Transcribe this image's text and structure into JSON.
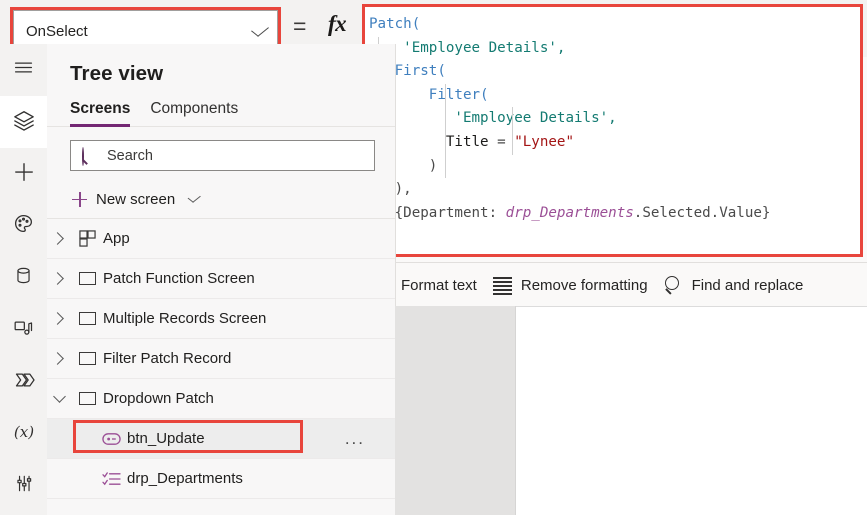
{
  "property_selector": {
    "value": "OnSelect",
    "chevron_icon": "chevron-down-icon"
  },
  "formula_bar": {
    "equals_sign": "=",
    "fx_symbol": "fx",
    "lines": [
      {
        "tokens": [
          {
            "t": "Patch(",
            "c": "fn"
          }
        ],
        "guides": 0
      },
      {
        "tokens": [
          {
            "t": "    ",
            "c": "plain"
          },
          {
            "t": "'Employee Details',",
            "c": "str"
          }
        ],
        "guides": 1
      },
      {
        "tokens": [
          {
            "t": "   ",
            "c": "plain"
          },
          {
            "t": "First(",
            "c": "fn"
          }
        ],
        "guides": 1
      },
      {
        "tokens": [
          {
            "t": "       ",
            "c": "plain"
          },
          {
            "t": "Filter(",
            "c": "fn"
          }
        ],
        "guides": 2
      },
      {
        "tokens": [
          {
            "t": "          ",
            "c": "plain"
          },
          {
            "t": "'Employee Details',",
            "c": "str"
          }
        ],
        "guides": 3
      },
      {
        "tokens": [
          {
            "t": "         ",
            "c": "plain"
          },
          {
            "t": "Title",
            "c": "ident"
          },
          {
            "t": " = ",
            "c": "punc"
          },
          {
            "t": "\"Lynee\"",
            "c": "dqst"
          }
        ],
        "guides": 3
      },
      {
        "tokens": [
          {
            "t": "       ",
            "c": "plain"
          },
          {
            "t": ")",
            "c": "punc"
          }
        ],
        "guides": 2
      },
      {
        "tokens": [
          {
            "t": "   ",
            "c": "plain"
          },
          {
            "t": "),",
            "c": "punc"
          }
        ],
        "guides": 1
      },
      {
        "tokens": [
          {
            "t": "   ",
            "c": "plain"
          },
          {
            "t": "{Department: ",
            "c": "punc"
          },
          {
            "t": "drp_Departments",
            "c": "ctrl"
          },
          {
            "t": ".Selected.Value}",
            "c": "punc"
          }
        ],
        "guides": 1
      },
      {
        "tokens": [
          {
            "t": ")",
            "c": "punc"
          }
        ],
        "guides": 0
      }
    ],
    "toolbar": {
      "format_text": "Format text",
      "remove_formatting": "Remove formatting",
      "find_and_replace": "Find and replace"
    }
  },
  "rail": {
    "items": [
      {
        "icon": "hamburger-menu-icon",
        "name": "menu",
        "active": false
      },
      {
        "icon": "layers-tree-view-icon",
        "name": "tree-view",
        "active": true
      },
      {
        "icon": "plus-insert-icon",
        "name": "insert",
        "active": false
      },
      {
        "icon": "palette-theme-icon",
        "name": "theme",
        "active": false
      },
      {
        "icon": "database-data-icon",
        "name": "data",
        "active": false
      },
      {
        "icon": "media-icon",
        "name": "media",
        "active": false
      },
      {
        "icon": "power-automate-icon",
        "name": "power-automate",
        "active": false
      },
      {
        "icon": "variables-fx-icon",
        "name": "variables",
        "active": false
      },
      {
        "icon": "advanced-tools-icon",
        "name": "advanced-tools",
        "active": false
      }
    ]
  },
  "tree_panel": {
    "title": "Tree view",
    "tabs": [
      {
        "label": "Screens",
        "selected": true
      },
      {
        "label": "Components",
        "selected": false
      }
    ],
    "search": {
      "placeholder": "Search",
      "value": "",
      "icon": "search-icon"
    },
    "new_screen": {
      "label": "New screen",
      "plus_icon": "plus-icon",
      "chevron_icon": "chevron-down-icon"
    },
    "items": [
      {
        "label": "App",
        "icon": "app-icon",
        "expand": "collapsed",
        "level": 0,
        "selected": false
      },
      {
        "label": "Patch Function Screen",
        "icon": "screen-icon",
        "expand": "collapsed",
        "level": 0,
        "selected": false
      },
      {
        "label": "Multiple Records Screen",
        "icon": "screen-icon",
        "expand": "collapsed",
        "level": 0,
        "selected": false
      },
      {
        "label": "Filter Patch Record",
        "icon": "screen-icon",
        "expand": "collapsed",
        "level": 0,
        "selected": false
      },
      {
        "label": "Dropdown Patch",
        "icon": "screen-icon",
        "expand": "expanded",
        "level": 0,
        "selected": false
      },
      {
        "label": "btn_Update",
        "icon": "button-control-icon",
        "expand": "none",
        "level": 1,
        "selected": true,
        "overflow": "..."
      },
      {
        "label": "drp_Departments",
        "icon": "dropdown-control-icon",
        "expand": "none",
        "level": 1,
        "selected": false
      }
    ]
  },
  "colors": {
    "annotation_red": "#e8453c",
    "accent_purple": "#742774",
    "panel_bg": "#f3f2f1",
    "function_blue": "#3f7fbe",
    "string_teal": "#147b72",
    "string_red": "#a31515",
    "control_purple": "#9b4f96"
  }
}
